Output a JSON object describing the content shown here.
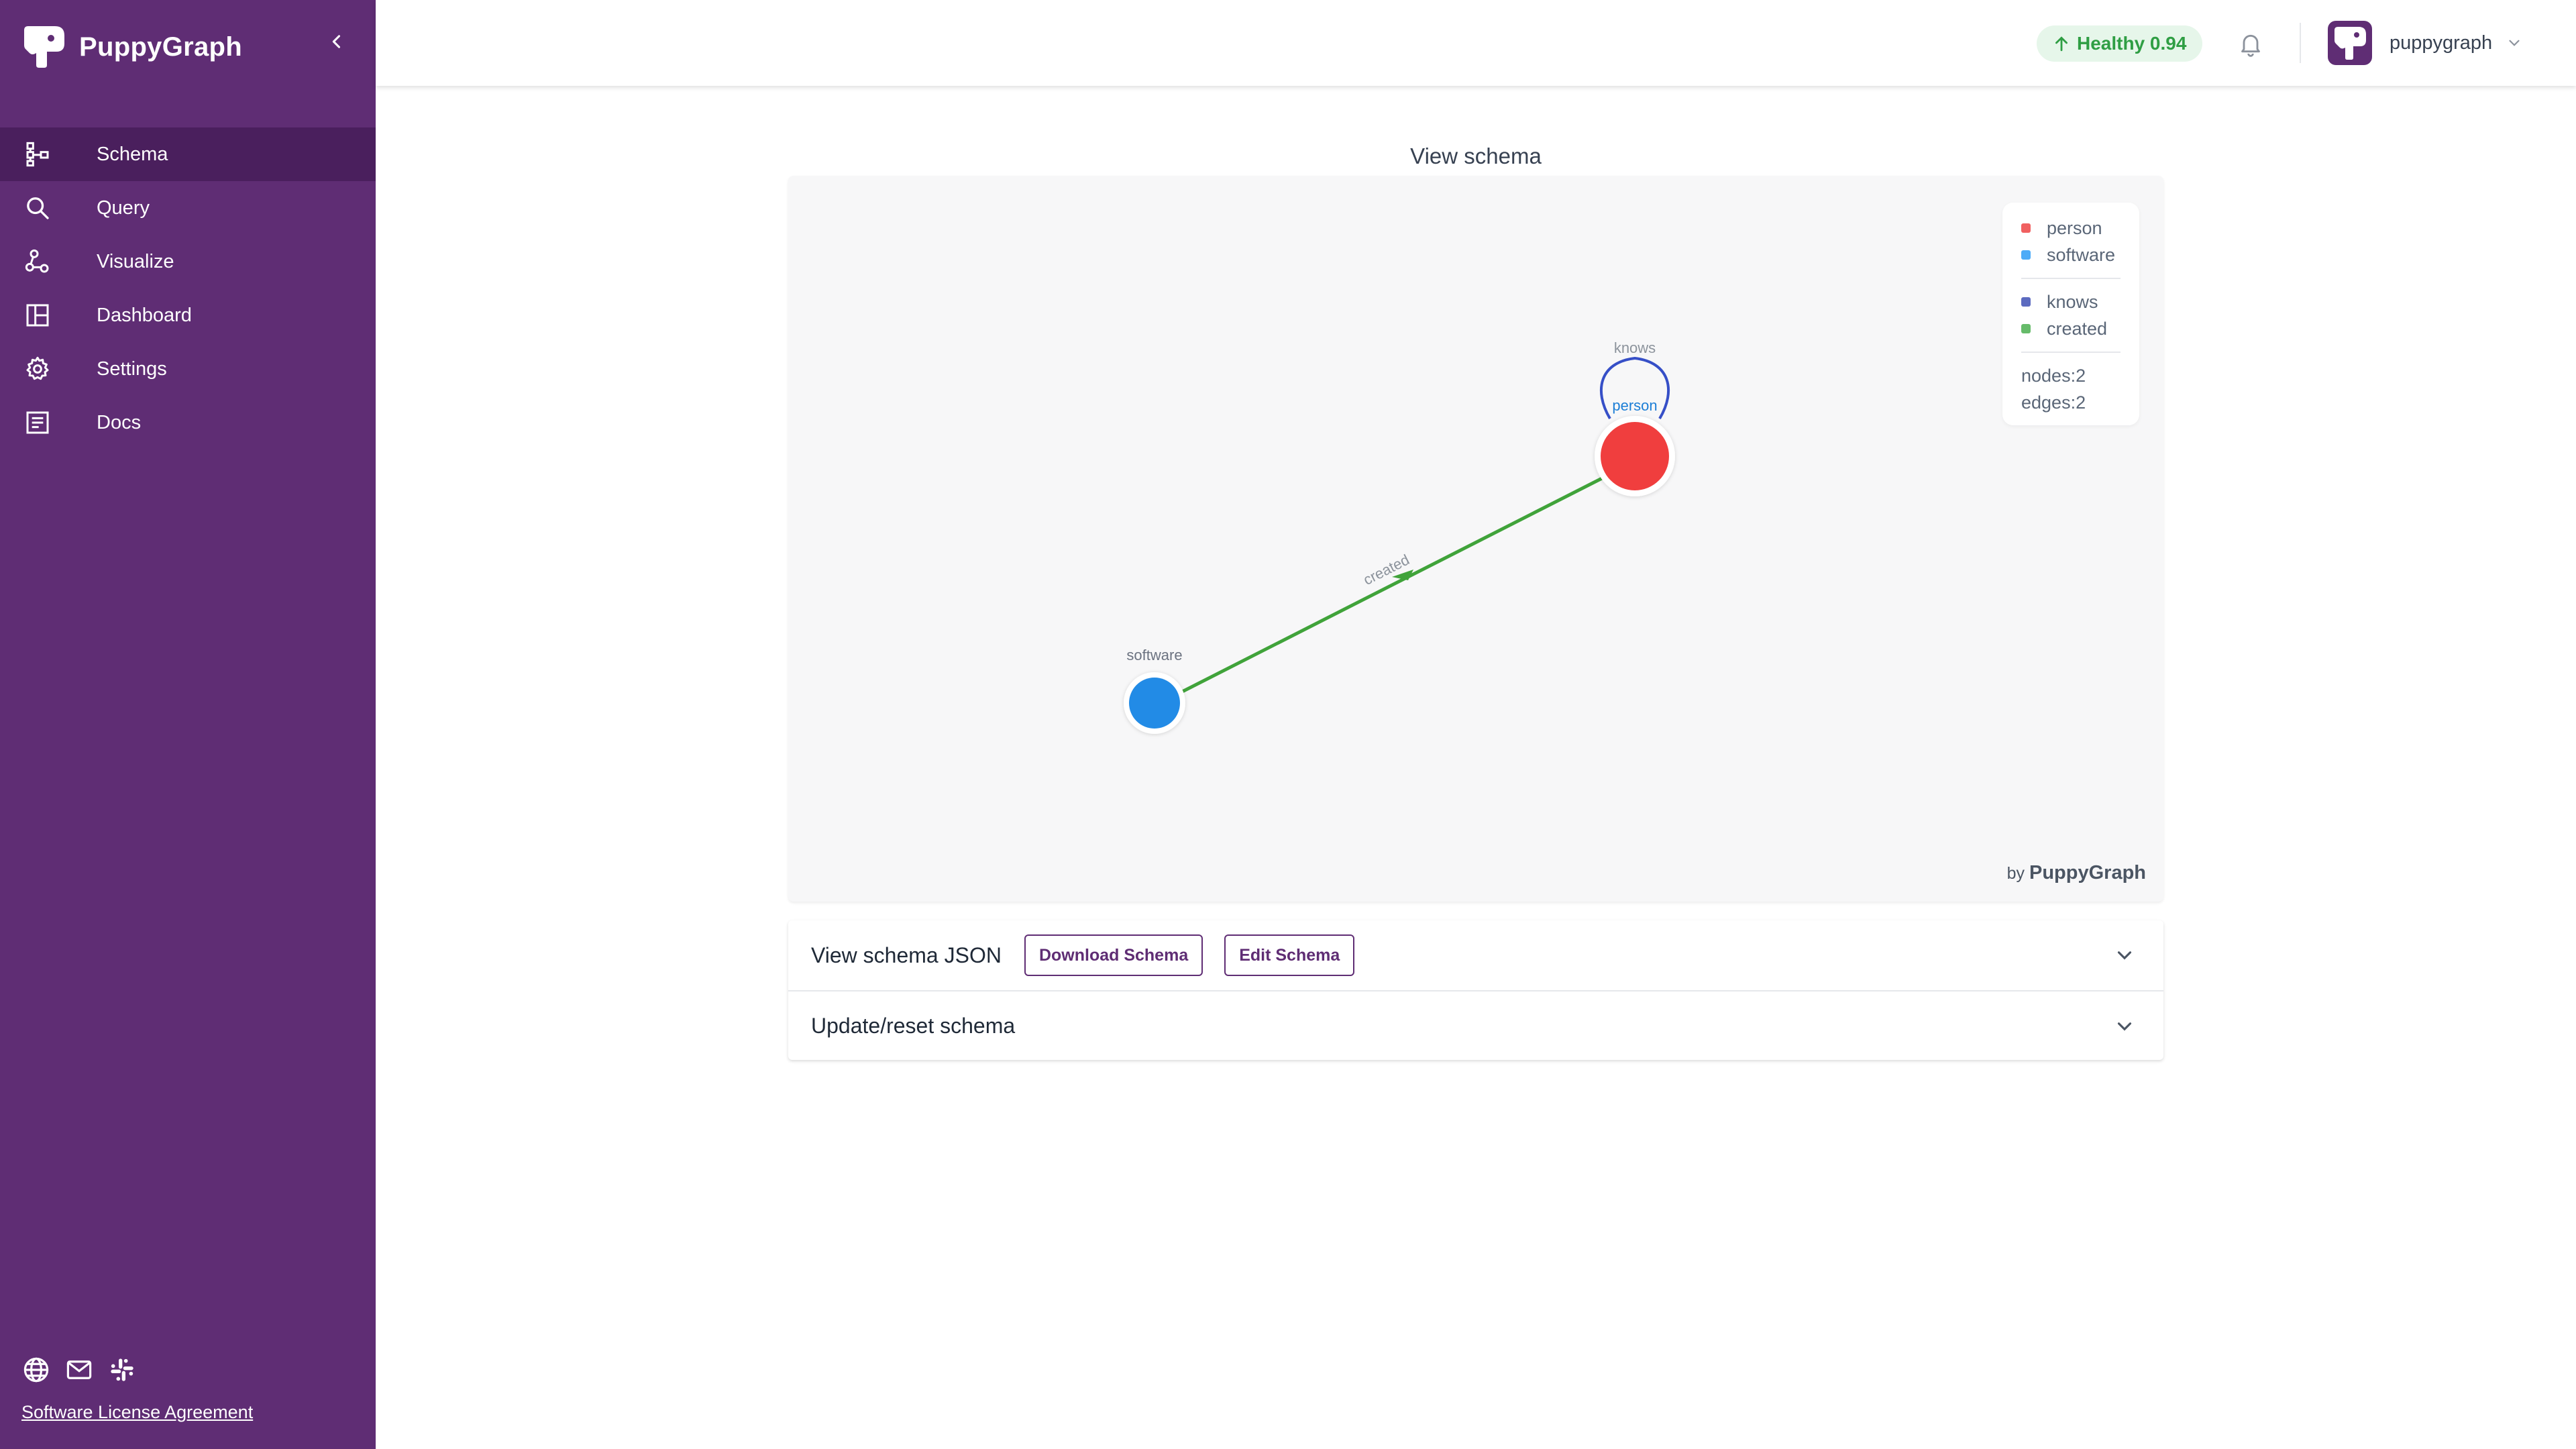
{
  "app": {
    "name": "PuppyGraph"
  },
  "sidebar": {
    "items": [
      {
        "label": "Schema",
        "icon": "schema-icon",
        "active": true
      },
      {
        "label": "Query",
        "icon": "search-icon",
        "active": false
      },
      {
        "label": "Visualize",
        "icon": "visualize-icon",
        "active": false
      },
      {
        "label": "Dashboard",
        "icon": "dashboard-icon",
        "active": false
      },
      {
        "label": "Settings",
        "icon": "gear-icon",
        "active": false
      },
      {
        "label": "Docs",
        "icon": "docs-icon",
        "active": false
      }
    ],
    "footer": {
      "icons": [
        "globe-icon",
        "mail-icon",
        "slack-icon"
      ],
      "license_link": "Software License Agreement"
    }
  },
  "header": {
    "health": {
      "label": "Healthy 0.94",
      "color": "#2f9e44"
    },
    "user": {
      "name": "puppygraph"
    }
  },
  "main": {
    "title": "View schema",
    "graph": {
      "nodes": [
        {
          "label": "person",
          "color": "#f03e3e"
        },
        {
          "label": "software",
          "color": "#228be6"
        }
      ],
      "edges": [
        {
          "label": "knows",
          "color": "#364fc7"
        },
        {
          "label": "created",
          "color": "#40a33a"
        }
      ],
      "legend": {
        "node_types": [
          {
            "label": "person",
            "color": "#f06060"
          },
          {
            "label": "software",
            "color": "#4dabf7"
          }
        ],
        "edge_types": [
          {
            "label": "knows",
            "color": "#5c6bc0"
          },
          {
            "label": "created",
            "color": "#66bb6a"
          }
        ],
        "stats": {
          "nodes": "nodes:2",
          "edges": "edges:2"
        }
      },
      "byline": {
        "prefix": "by",
        "brand": "PuppyGraph"
      }
    },
    "accordion": {
      "json_section": {
        "title": "View schema JSON",
        "download_label": "Download Schema",
        "edit_label": "Edit Schema"
      },
      "update_section": {
        "title": "Update/reset schema"
      }
    }
  },
  "colors": {
    "sidebar_bg": "#5f2d74",
    "sidebar_active": "#4a1f5d",
    "accent": "#5f2d74"
  }
}
